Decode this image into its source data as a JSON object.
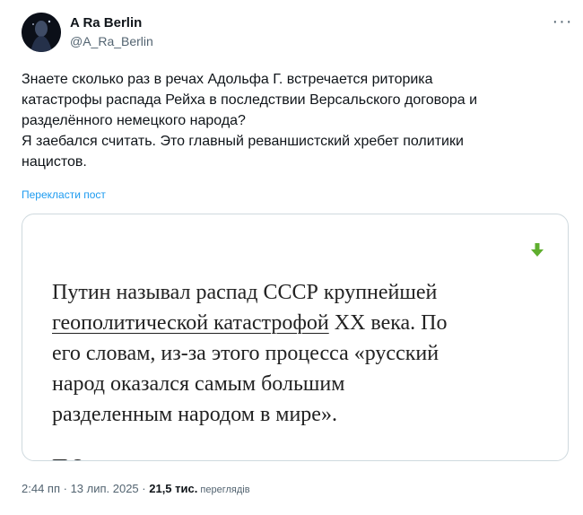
{
  "author": {
    "display_name": "A Ra Berlin",
    "handle": "@A_Ra_Berlin",
    "more_icon": "more-horizontal-icon"
  },
  "tweet": {
    "lines": [
      "Знаете сколько раз в речах Адольфа Г. встречается риторика",
      "катастрофы распада Рейха в последствии Версальского договора и",
      "разделённого немецкого народа?",
      "Я заебался считать. Это главный реваншистский хребет политики",
      "нацистов."
    ],
    "translate_label": "Перекласти пост"
  },
  "media": {
    "icon": "green-down-arrow-icon",
    "line1": "Путин называл распад СССР крупнейшей",
    "line2_link": "геополитической катастрофой",
    "line2_rest": " XX века. По",
    "line3": "его словам, из-за этого процесса «русский",
    "line4": "народ оказался самым большим",
    "line5": "разделенным народом в мире».",
    "cut_line": "П                              З"
  },
  "meta": {
    "time": "2:44 пп",
    "sep1": " · ",
    "date": "13 лип. 2025",
    "sep2": " · ",
    "views_count": "21,5 тис.",
    "views_label": " переглядів"
  },
  "colors": {
    "accent": "#1d9bf0",
    "secondary_text": "#536471",
    "border": "#cfd9de",
    "arrow_green": "#5fae2e"
  }
}
